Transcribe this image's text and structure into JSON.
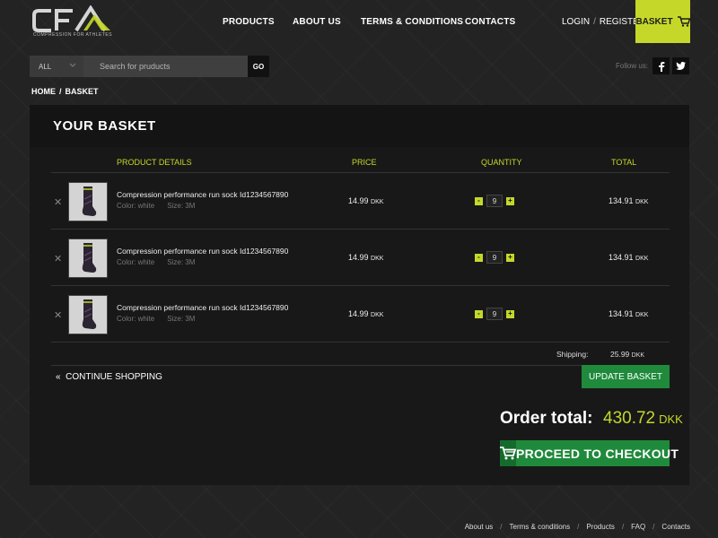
{
  "brand": {
    "logo_text": "CFA",
    "tagline": "COMPRESSION FOR ATHLETES",
    "accent_color": "#c5d82a",
    "button_green": "#1f8a3b"
  },
  "nav": {
    "items": [
      {
        "label": "PRODUCTS"
      },
      {
        "label": "ABOUT US"
      },
      {
        "label": "TERMS & CONDITIONS"
      },
      {
        "label": "CONTACTS"
      }
    ],
    "login": "LOGIN",
    "auth_separator": "/",
    "register": "REGISTER",
    "basket_label": "BASKET"
  },
  "search": {
    "category": "ALL",
    "placeholder": "Search for pruducts",
    "go_label": "GO"
  },
  "social": {
    "follow_label": "Follow us:",
    "icons": [
      "facebook-icon",
      "twitter-icon"
    ]
  },
  "breadcrumb": {
    "home": "HOME",
    "separator": "/",
    "current": "BASKET"
  },
  "basket": {
    "title": "YOUR BASKET",
    "columns": {
      "details": "PRODUCT DETAILS",
      "price": "PRICE",
      "quantity": "QUANTITY",
      "total": "TOTAL"
    },
    "items": [
      {
        "name": "Compression performance run sock Id1234567890",
        "color": "Color: white",
        "size": "Size: 3M",
        "price": "14.99",
        "price_currency": "DKK",
        "qty": "9",
        "total": "134.91",
        "total_currency": "DKK"
      },
      {
        "name": "Compression performance run sock Id1234567890",
        "color": "Color: white",
        "size": "Size: 3M",
        "price": "14.99",
        "price_currency": "DKK",
        "qty": "9",
        "total": "134.91",
        "total_currency": "DKK"
      },
      {
        "name": "Compression performance run sock Id1234567890",
        "color": "Color: white",
        "size": "Size: 3M",
        "price": "14.99",
        "price_currency": "DKK",
        "qty": "9",
        "total": "134.91",
        "total_currency": "DKK"
      }
    ],
    "shipping_label": "Shipping:",
    "shipping_value": "25.99",
    "shipping_currency": "DKK",
    "continue_label": "CONTINUE SHOPPING",
    "continue_icon": "«",
    "update_label": "UPDATE BASKET",
    "order_total_label": "Order total:",
    "order_total_value": "430.72",
    "order_total_currency": "DKK",
    "checkout_label": "PROCEED TO CHECKOUT",
    "remove_symbol": "✕",
    "minus_symbol": "-",
    "plus_symbol": "+"
  },
  "footer": {
    "links": [
      "About us",
      "Terms & conditions",
      "Products",
      "FAQ",
      "Contacts"
    ],
    "separator": "/"
  }
}
